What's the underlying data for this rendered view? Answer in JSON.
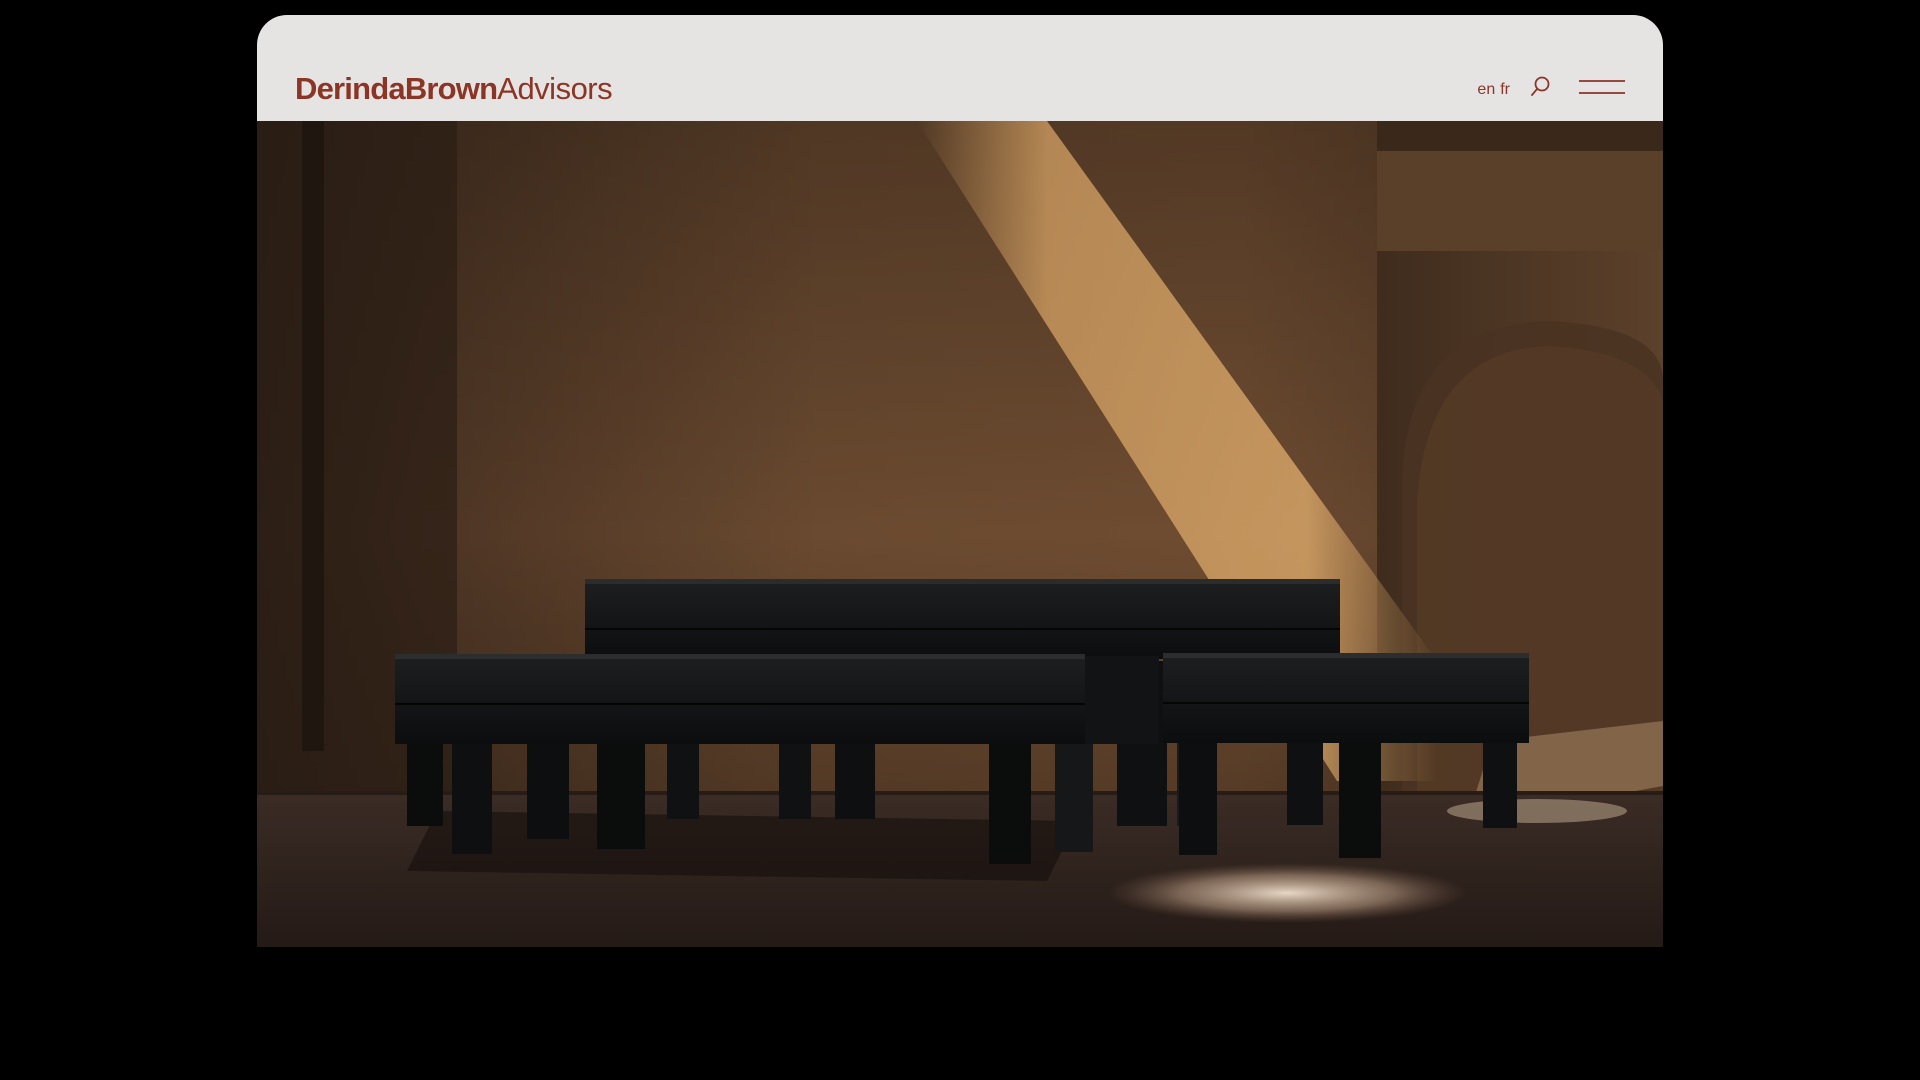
{
  "site": {
    "logo_bold": "DerindaBrown",
    "logo_light": "Advisors"
  },
  "nav": {
    "lang_en": "en",
    "lang_fr": "fr",
    "search_icon": "search-icon",
    "menu_icon": "hamburger-menu-icon"
  },
  "hero": {
    "image_subject": "dark wooden benches under diagonal sunlight against earthen wall"
  },
  "colors": {
    "brand": "#8b3527",
    "header_bg": "#e6e3e3",
    "page_bg": "#000000"
  }
}
